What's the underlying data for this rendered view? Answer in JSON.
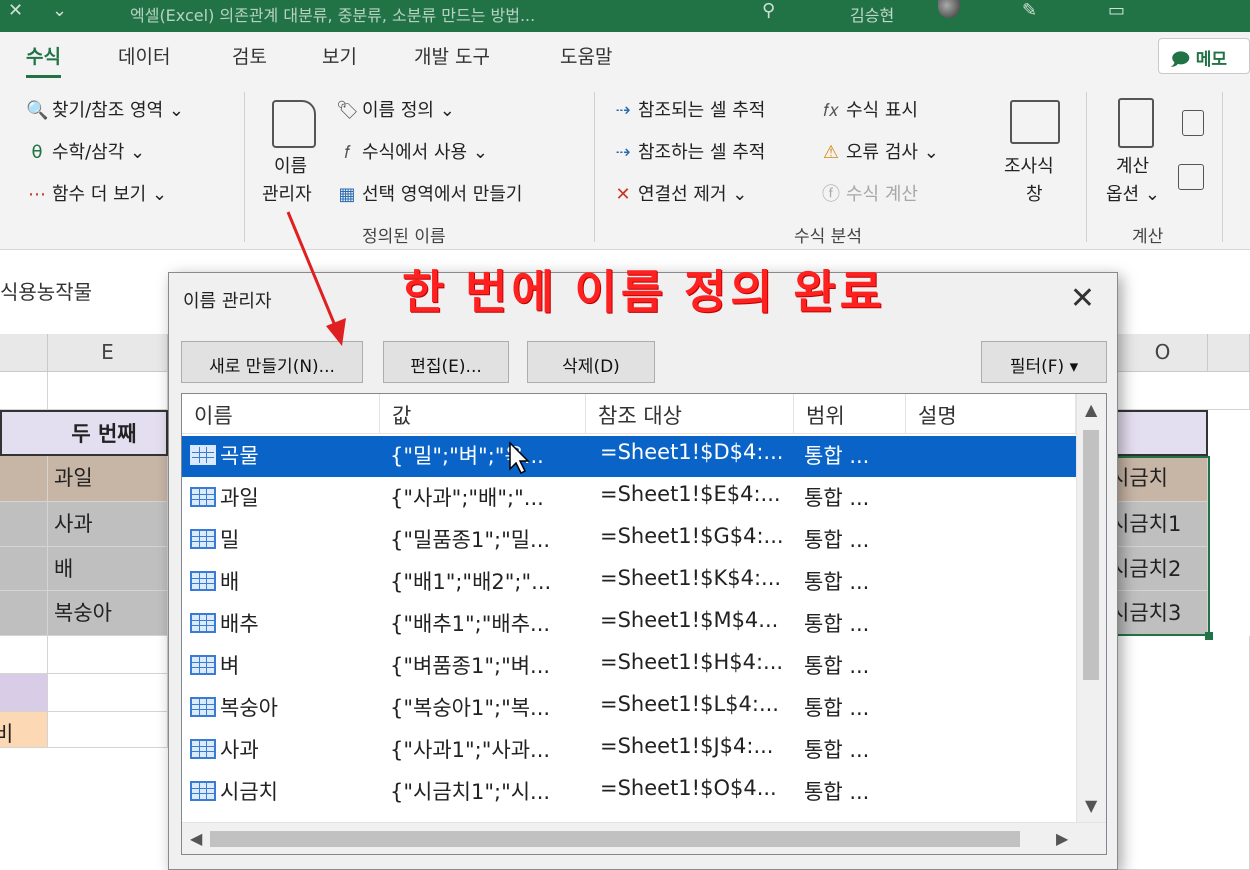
{
  "window": {
    "title_text": "엑셀(Excel) 의존관계 대분류, 중분류, 소분류 만드는 방법...",
    "user": "김승현"
  },
  "ribbon": {
    "tabs": [
      "수식",
      "데이터",
      "검토",
      "보기",
      "개발 도구",
      "도움말"
    ],
    "active_tab": "수식",
    "memo_label": "메모",
    "left_items": [
      "찾기/참조 영역",
      "수학/삼각",
      "함수 더 보기"
    ],
    "name_manager_label_1": "이름",
    "name_manager_label_2": "관리자",
    "defined_names_items": [
      "이름 정의",
      "수식에서 사용",
      "선택 영역에서 만들기"
    ],
    "defined_names_group": "정의된 이름",
    "audit_items_left": [
      "참조되는 셀 추적",
      "참조하는 셀 추적",
      "연결선 제거"
    ],
    "audit_items_right": [
      "수식 표시",
      "오류 검사",
      "수식 계산"
    ],
    "audit_group": "수식 분석",
    "watch_label_1": "조사식",
    "watch_label_2": "창",
    "calc_options_1": "계산",
    "calc_options_2": "옵션",
    "calc_group": "계산"
  },
  "sheet": {
    "namebox_text": "식용농작물",
    "col_e": "E",
    "col_o": "O",
    "header_cell": "두 번째",
    "e_cells": [
      "과일",
      "사과",
      "배",
      "복숭아"
    ],
    "o_cells": [
      "시금치",
      "시금치1",
      "시금치2",
      "시금치3"
    ],
    "partial_cell": "비"
  },
  "annotation": {
    "headline": "한 번에 이름 정의 완료"
  },
  "dialog": {
    "title": "이름 관리자",
    "close_glyph": "✕",
    "buttons": {
      "new": "새로 만들기(N)...",
      "edit": "편집(E)...",
      "delete": "삭제(D)",
      "filter": "필터(F) ▾"
    },
    "columns": [
      "이름",
      "값",
      "참조 대상",
      "범위",
      "설명"
    ],
    "rows": [
      {
        "name": "곡물",
        "value": "{\"밀\";\"벼\";\"옥...",
        "refers_to": "=Sheet1!$D$4:...",
        "scope": "통합 ...",
        "selected": true
      },
      {
        "name": "과일",
        "value": "{\"사과\";\"배\";\"...",
        "refers_to": "=Sheet1!$E$4:...",
        "scope": "통합 ..."
      },
      {
        "name": "밀",
        "value": "{\"밀품종1\";\"밀...",
        "refers_to": "=Sheet1!$G$4:...",
        "scope": "통합 ..."
      },
      {
        "name": "배",
        "value": "{\"배1\";\"배2\";\"...",
        "refers_to": "=Sheet1!$K$4:...",
        "scope": "통합 ..."
      },
      {
        "name": "배추",
        "value": "{\"배추1\";\"배추...",
        "refers_to": "=Sheet1!$M$4...",
        "scope": "통합 ..."
      },
      {
        "name": "벼",
        "value": "{\"벼품종1\";\"벼...",
        "refers_to": "=Sheet1!$H$4:...",
        "scope": "통합 ..."
      },
      {
        "name": "복숭아",
        "value": "{\"복숭아1\";\"복...",
        "refers_to": "=Sheet1!$L$4:...",
        "scope": "통합 ..."
      },
      {
        "name": "사과",
        "value": "{\"사과1\";\"사과...",
        "refers_to": "=Sheet1!$J$4:...",
        "scope": "통합 ..."
      },
      {
        "name": "시금치",
        "value": "{\"시금치1\";\"시...",
        "refers_to": "=Sheet1!$O$4...",
        "scope": "통합 ..."
      }
    ]
  },
  "colors": {
    "excel_green": "#217346",
    "selection_blue": "#0a64c8",
    "annotation_red": "#ff2020"
  }
}
